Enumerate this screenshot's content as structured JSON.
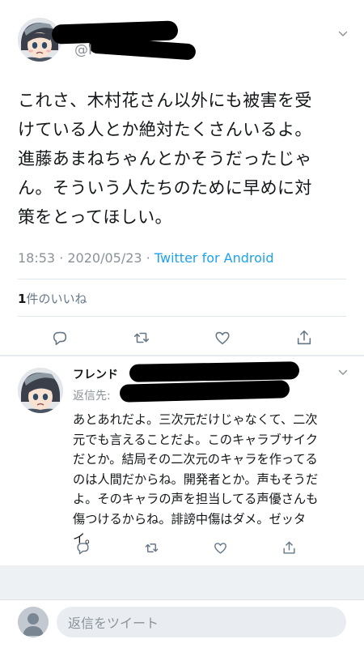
{
  "main_tweet": {
    "handle_prefix": "@I",
    "text": "これさ、木村花さん以外にも被害を受\nけている人とか絶対たくさんいるよ。\n進藤あまねちゃんとかそうだったじゃ\nん。そういう人たちのために早めに対\n策をとってほしい。",
    "time": "18:53",
    "date": "2020/05/23",
    "source": "Twitter for Android",
    "likes_count": "1",
    "likes_label": "件のいいね"
  },
  "reply_tweet": {
    "name_fragment": "フレンド",
    "reply_to_label": "返信先:",
    "text": "あとあれだよ。三次元だけじゃなくて、二次\n元でも言えることだよ。このキャラブサイク\nだとか。結局その二次元のキャラを作ってる\nのは人間だからね。開発者とか。声もそうだ\nよ。そのキャラの声を担当してる声優さんも\n傷つけるからね。誹謗中傷はダメ。ゼッタ\nイ。"
  },
  "compose": {
    "placeholder": "返信をツイート"
  },
  "icons": {
    "reply": "reply-icon",
    "retweet": "retweet-icon",
    "like": "heart-icon",
    "share": "share-icon",
    "menu": "chevron-down-icon"
  },
  "colors": {
    "link": "#1da1f2",
    "muted": "#8a9299",
    "text": "#14171a",
    "icon": "#657786"
  }
}
